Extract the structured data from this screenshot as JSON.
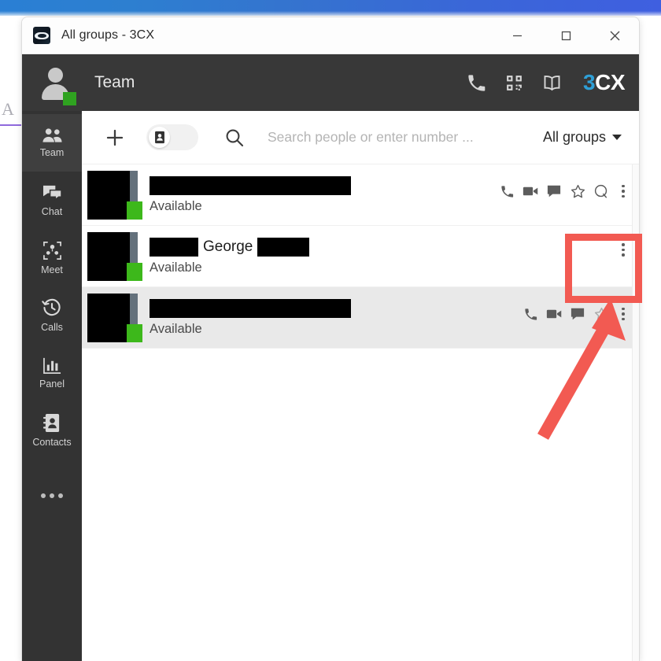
{
  "window": {
    "title": "All groups - 3CX",
    "app_icon": "3cx-app-icon",
    "controls": {
      "minimize": "minimize",
      "maximize": "maximize",
      "close": "close"
    }
  },
  "header": {
    "title": "Team",
    "user_presence_color": "#2fa220",
    "actions": [
      {
        "name": "dialpad-phone-icon",
        "label": "Phone"
      },
      {
        "name": "qr-code-icon",
        "label": "QR code"
      },
      {
        "name": "book-icon",
        "label": "Directory"
      }
    ],
    "brand": {
      "prefix": "3",
      "suffix": "CX",
      "accent": "#2e9fd6"
    }
  },
  "sidebar": {
    "items": [
      {
        "label": "Team",
        "icon": "team-icon",
        "active": true
      },
      {
        "label": "Chat",
        "icon": "chat-icon",
        "active": false
      },
      {
        "label": "Meet",
        "icon": "meet-icon",
        "active": false
      },
      {
        "label": "Calls",
        "icon": "calls-icon",
        "active": false
      },
      {
        "label": "Panel",
        "icon": "panel-icon",
        "active": false
      },
      {
        "label": "Contacts",
        "icon": "contacts-icon",
        "active": false
      }
    ],
    "more_label": "More"
  },
  "toolbar": {
    "add_label": "+",
    "toggle_icon": "contact-card-icon",
    "search_icon": "search-icon",
    "search_value": "",
    "search_placeholder": "Search people or enter number ...",
    "group_filter_label": "All groups"
  },
  "contacts": {
    "rows": [
      {
        "name_redacted": true,
        "name_text": "",
        "presence": "Available",
        "presence_color": "#3db81b",
        "selected": false,
        "actions": [
          "call-icon",
          "video-icon",
          "chat-icon",
          "star-icon",
          "queue-icon",
          "kebab-menu-icon"
        ]
      },
      {
        "name_redacted": true,
        "name_text": "George",
        "presence": "Available",
        "presence_color": "#3db81b",
        "selected": false,
        "actions": [
          "kebab-menu-icon"
        ]
      },
      {
        "name_redacted": true,
        "name_text": "",
        "presence": "Available",
        "presence_color": "#3db81b",
        "selected": true,
        "actions": [
          "call-icon",
          "video-icon",
          "chat-icon",
          "star-icon",
          "kebab-menu-icon"
        ]
      }
    ]
  },
  "annotation": {
    "highlight_color": "#f25a52",
    "target": "kebab-menu-icon-row-2"
  },
  "backdrop": {
    "letter": "A"
  }
}
